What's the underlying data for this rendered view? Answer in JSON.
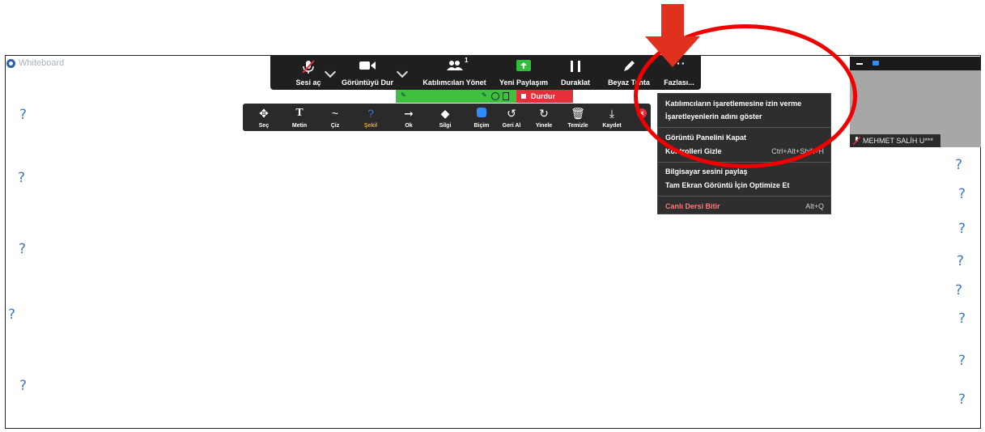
{
  "whiteboard": {
    "title": "Whiteboard"
  },
  "meeting_bar": {
    "buttons": [
      {
        "label": "Sesi aç",
        "icon": "muted-mic-icon"
      },
      {
        "label": "Görüntüyü Dur",
        "icon": "video-camera-icon"
      },
      {
        "label": "Katılımcıları Yönet",
        "icon": "participants-icon",
        "badge": "1"
      },
      {
        "label": "Yeni Paylaşım",
        "icon": "share-screen-icon"
      },
      {
        "label": "Duraklat",
        "icon": "pause-icon"
      },
      {
        "label": "Beyaz Tahta",
        "icon": "pen-icon"
      },
      {
        "label": "Fazlası...",
        "icon": "more-icon"
      }
    ]
  },
  "recording_strip": {
    "stop_label": "Durdur"
  },
  "annotation_toolbar": {
    "tools": [
      {
        "label": "Seç",
        "icon": "move-icon"
      },
      {
        "label": "Metin",
        "icon": "text-icon"
      },
      {
        "label": "Çiz",
        "icon": "draw-icon"
      },
      {
        "label": "Şekil",
        "icon": "shape-icon",
        "active": true
      },
      {
        "label": "Ok",
        "icon": "arrow-icon"
      },
      {
        "label": "Silgi",
        "icon": "eraser-icon"
      },
      {
        "label": "Biçim",
        "icon": "format-icon"
      },
      {
        "label": "Geri Al",
        "icon": "undo-icon"
      },
      {
        "label": "Yinele",
        "icon": "redo-icon"
      },
      {
        "label": "Temizle",
        "icon": "trash-icon"
      },
      {
        "label": "Kaydet",
        "icon": "save-icon"
      }
    ],
    "active_color": "#f2a51c"
  },
  "more_menu": {
    "items": [
      {
        "label": "Katılımcıların işaretlemesine izin verme",
        "shortcut": ""
      },
      {
        "label": "İşaretleyenlerin adını göster",
        "shortcut": ""
      },
      {
        "label": "Görüntü Panelini Kapat",
        "shortcut": ""
      },
      {
        "label": "Kontrolleri Gizle",
        "shortcut": "Ctrl+Alt+Shift+H"
      },
      {
        "label": "Bilgisayar sesini paylaş",
        "shortcut": ""
      },
      {
        "label": "Tam Ekran Görüntü İçin Optimize Et",
        "shortcut": ""
      },
      {
        "label": "Canlı Dersi Bitir",
        "shortcut": "Alt+Q"
      }
    ]
  },
  "video_panel": {
    "participant_name": "MEHMET SALİH U***"
  },
  "canvas": {
    "glyph": "?"
  },
  "colors": {
    "highlight_ring": "#f00000",
    "arrow": "#e0301e",
    "question_mark": "#3f79c4",
    "record_green": "#3fc13f",
    "record_red": "#e3303a"
  }
}
